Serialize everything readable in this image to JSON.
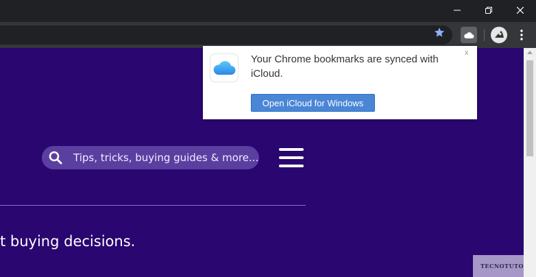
{
  "window": {
    "controls": {
      "minimize_icon": "minimize-icon",
      "maximize_icon": "restore-icon",
      "close_icon": "close-icon"
    }
  },
  "toolbar": {
    "bookmark_icon": "star-icon",
    "extension_icon": "icloud-icon",
    "menu_icon": "kebab-menu-icon",
    "accent_star": "#8ab4f8"
  },
  "page": {
    "search": {
      "placeholder": "Tips, tricks, buying guides & more..."
    },
    "tagline": "t buying decisions.",
    "background": "#2a0670"
  },
  "popup": {
    "message": "Your Chrome bookmarks are synced with iCloud.",
    "close_label": "x",
    "button_label": "Open iCloud for Windows",
    "button_color": "#4a86d6"
  },
  "watermark": {
    "text": "TECNOTUTO"
  }
}
